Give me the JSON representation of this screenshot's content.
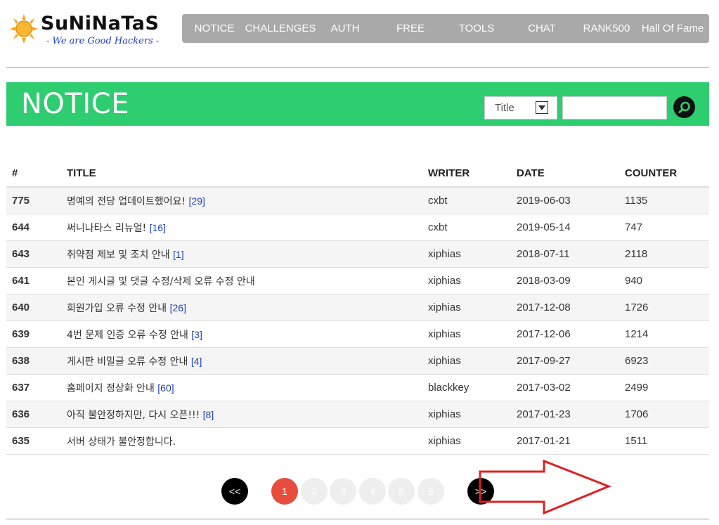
{
  "logo": {
    "title": "SuNiNaTaS",
    "tagline": "- We are Good Hackers -"
  },
  "nav": [
    {
      "label": "NOTICE"
    },
    {
      "label": "CHALLENGES"
    },
    {
      "label": "AUTH"
    },
    {
      "label": "FREE"
    },
    {
      "label": "TOOLS"
    },
    {
      "label": "CHAT"
    },
    {
      "label": "RANK500"
    },
    {
      "label": "Hall Of Fame"
    }
  ],
  "banner": {
    "title": "NOTICE"
  },
  "search": {
    "selected": "Title",
    "value": ""
  },
  "table": {
    "headers": {
      "num": "#",
      "title": "TITLE",
      "writer": "WRITER",
      "date": "DATE",
      "counter": "COUNTER"
    },
    "rows": [
      {
        "num": "775",
        "title": "명예의 전당 업데이트했어요!",
        "comments": "[29]",
        "writer": "cxbt",
        "date": "2019-06-03",
        "counter": "1135"
      },
      {
        "num": "644",
        "title": "써니나타스 리뉴얼!",
        "comments": "[16]",
        "writer": "cxbt",
        "date": "2019-05-14",
        "counter": "747"
      },
      {
        "num": "643",
        "title": "취약점 제보 및 조치 안내",
        "comments": "[1]",
        "writer": "xiphias",
        "date": "2018-07-11",
        "counter": "2118"
      },
      {
        "num": "641",
        "title": "본인 게시글 및 댓글 수정/삭제 오류 수정 안내",
        "comments": "",
        "writer": "xiphias",
        "date": "2018-03-09",
        "counter": "940"
      },
      {
        "num": "640",
        "title": "회원가입 오류 수정 안내",
        "comments": "[26]",
        "writer": "xiphias",
        "date": "2017-12-08",
        "counter": "1726"
      },
      {
        "num": "639",
        "title": "4번 문제 인증 오류 수정 안내",
        "comments": "[3]",
        "writer": "xiphias",
        "date": "2017-12-06",
        "counter": "1214"
      },
      {
        "num": "638",
        "title": "게시판 비밀글 오류 수정 안내",
        "comments": "[4]",
        "writer": "xiphias",
        "date": "2017-09-27",
        "counter": "6923"
      },
      {
        "num": "637",
        "title": "홈페이지 정상화 안내",
        "comments": "[60]",
        "writer": "blackkey",
        "date": "2017-03-02",
        "counter": "2499"
      },
      {
        "num": "636",
        "title": "아직 불안정하지만, 다시 오픈!!!",
        "comments": "[8]",
        "writer": "xiphias",
        "date": "2017-01-23",
        "counter": "1706"
      },
      {
        "num": "635",
        "title": "서버 상태가 불안정합니다.",
        "comments": "",
        "writer": "xiphias",
        "date": "2017-01-21",
        "counter": "1511"
      }
    ]
  },
  "pager": {
    "prev": "<<",
    "pages": [
      "1",
      "2",
      "3",
      "4",
      "5",
      "6"
    ],
    "current": "1",
    "next": ">>"
  },
  "colors": {
    "banner": "#2ecd70",
    "nav": "#a9a9a9",
    "active_page": "#e74c3c",
    "annotation_arrow": "#e02020",
    "link": "#1a3fc4"
  }
}
